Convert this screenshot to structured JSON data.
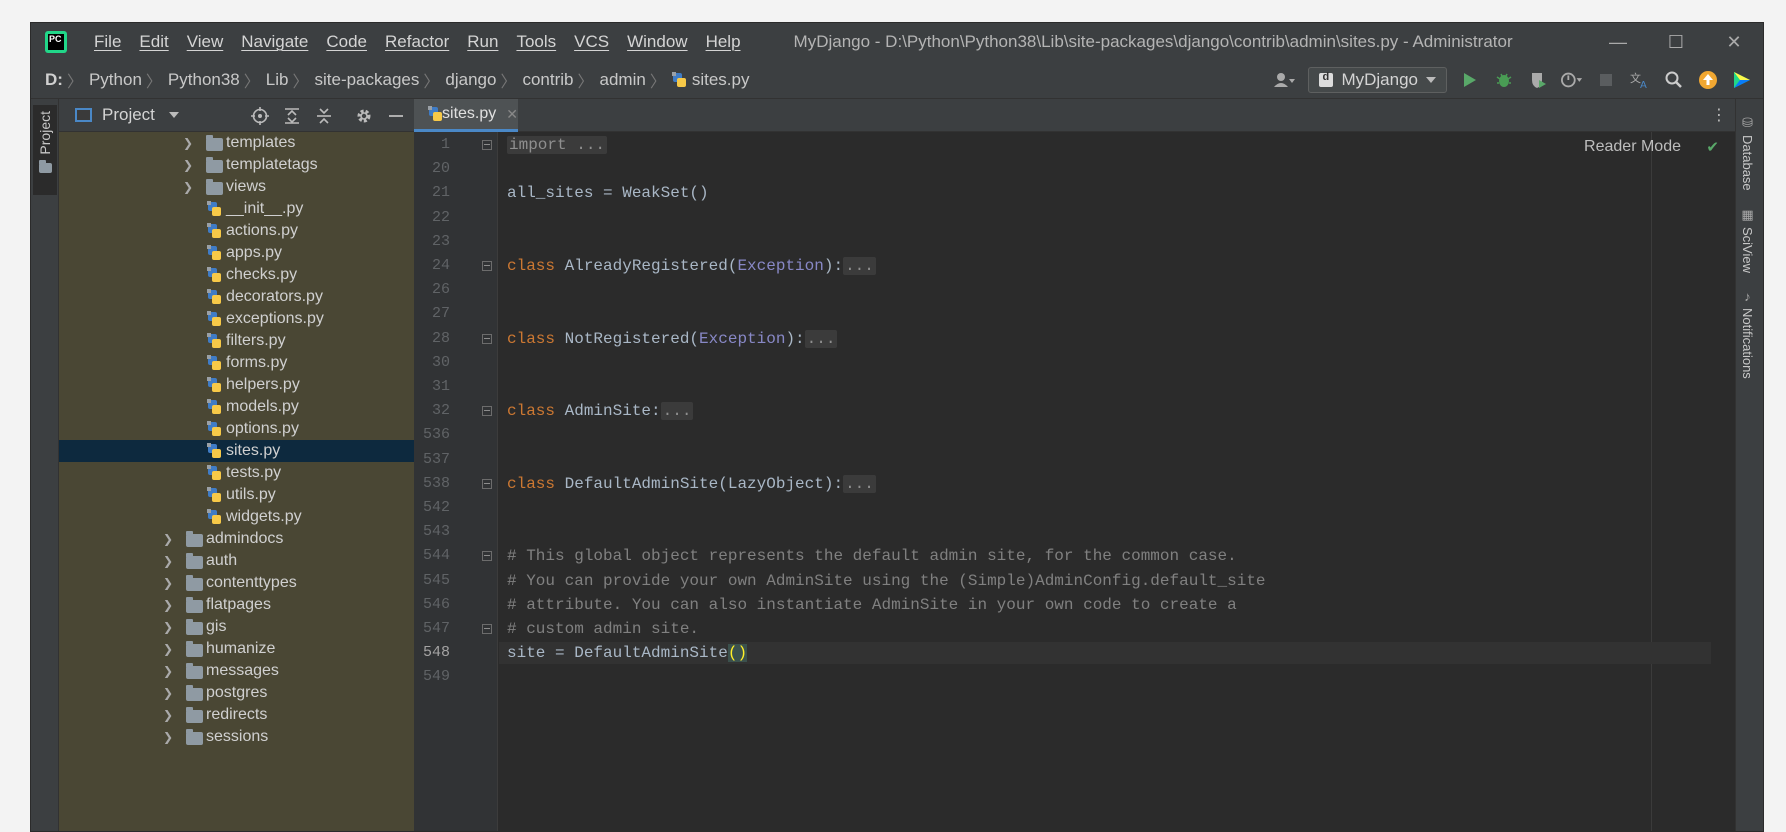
{
  "titlebar": {
    "app_icon_text": "PC",
    "menu": [
      "File",
      "Edit",
      "View",
      "Navigate",
      "Code",
      "Refactor",
      "Run",
      "Tools",
      "VCS",
      "Window",
      "Help"
    ],
    "title": "MyDjango - D:\\Python\\Python38\\Lib\\site-packages\\django\\contrib\\admin\\sites.py - Administrator",
    "controls": {
      "minimize": "—",
      "maximize": "☐",
      "close": "✕"
    }
  },
  "breadcrumb": [
    "D:",
    "Python",
    "Python38",
    "Lib",
    "site-packages",
    "django",
    "contrib",
    "admin",
    "sites.py"
  ],
  "toolbar": {
    "run_config": "MyDjango",
    "icons": [
      "user-icon",
      "run-icon",
      "debug-icon",
      "coverage-icon",
      "profile-icon",
      "stop-icon",
      "translate-icon",
      "search-icon",
      "update-icon",
      "jetbrains-icon"
    ]
  },
  "left_stripe": {
    "project_label": "Project"
  },
  "project_panel": {
    "title": "Project",
    "tree": [
      {
        "label": "templates",
        "type": "folder",
        "level": 2,
        "expandable": true
      },
      {
        "label": "templatetags",
        "type": "folder",
        "level": 2,
        "expandable": true
      },
      {
        "label": "views",
        "type": "folder",
        "level": 2,
        "expandable": true
      },
      {
        "label": "__init__.py",
        "type": "py",
        "level": 2
      },
      {
        "label": "actions.py",
        "type": "py",
        "level": 2
      },
      {
        "label": "apps.py",
        "type": "py",
        "level": 2
      },
      {
        "label": "checks.py",
        "type": "py",
        "level": 2
      },
      {
        "label": "decorators.py",
        "type": "py",
        "level": 2
      },
      {
        "label": "exceptions.py",
        "type": "py",
        "level": 2
      },
      {
        "label": "filters.py",
        "type": "py",
        "level": 2
      },
      {
        "label": "forms.py",
        "type": "py",
        "level": 2
      },
      {
        "label": "helpers.py",
        "type": "py",
        "level": 2
      },
      {
        "label": "models.py",
        "type": "py",
        "level": 2
      },
      {
        "label": "options.py",
        "type": "py",
        "level": 2
      },
      {
        "label": "sites.py",
        "type": "py",
        "level": 2,
        "selected": true
      },
      {
        "label": "tests.py",
        "type": "py",
        "level": 2
      },
      {
        "label": "utils.py",
        "type": "py",
        "level": 2
      },
      {
        "label": "widgets.py",
        "type": "py",
        "level": 2
      },
      {
        "label": "admindocs",
        "type": "folder",
        "level": 1,
        "expandable": true
      },
      {
        "label": "auth",
        "type": "folder",
        "level": 1,
        "expandable": true
      },
      {
        "label": "contenttypes",
        "type": "folder",
        "level": 1,
        "expandable": true
      },
      {
        "label": "flatpages",
        "type": "folder",
        "level": 1,
        "expandable": true
      },
      {
        "label": "gis",
        "type": "folder",
        "level": 1,
        "expandable": true
      },
      {
        "label": "humanize",
        "type": "folder",
        "level": 1,
        "expandable": true
      },
      {
        "label": "messages",
        "type": "folder",
        "level": 1,
        "expandable": true
      },
      {
        "label": "postgres",
        "type": "folder",
        "level": 1,
        "expandable": true
      },
      {
        "label": "redirects",
        "type": "folder",
        "level": 1,
        "expandable": true
      },
      {
        "label": "sessions",
        "type": "folder",
        "level": 1,
        "expandable": true
      }
    ]
  },
  "editor": {
    "tab_label": "sites.py",
    "reader_mode": "Reader Mode",
    "lines": [
      {
        "n": "1",
        "fold": true,
        "parts": [
          {
            "t": "import ...",
            "c": "collapsed"
          }
        ]
      },
      {
        "n": "20",
        "parts": []
      },
      {
        "n": "21",
        "parts": [
          {
            "t": "all_sites = WeakSet()",
            "c": ""
          }
        ]
      },
      {
        "n": "22",
        "parts": []
      },
      {
        "n": "23",
        "parts": []
      },
      {
        "n": "24",
        "fold": true,
        "parts": [
          {
            "t": "class ",
            "c": "kw"
          },
          {
            "t": "AlreadyRegistered(",
            "c": ""
          },
          {
            "t": "Exception",
            "c": "builtin"
          },
          {
            "t": "):",
            "c": ""
          },
          {
            "t": "...",
            "c": "collapsed"
          }
        ]
      },
      {
        "n": "26",
        "parts": []
      },
      {
        "n": "27",
        "parts": []
      },
      {
        "n": "28",
        "fold": true,
        "parts": [
          {
            "t": "class ",
            "c": "kw"
          },
          {
            "t": "NotRegistered(",
            "c": ""
          },
          {
            "t": "Exception",
            "c": "builtin"
          },
          {
            "t": "):",
            "c": ""
          },
          {
            "t": "...",
            "c": "collapsed"
          }
        ]
      },
      {
        "n": "30",
        "parts": []
      },
      {
        "n": "31",
        "parts": []
      },
      {
        "n": "32",
        "fold": true,
        "parts": [
          {
            "t": "class ",
            "c": "kw"
          },
          {
            "t": "AdminSite:",
            "c": ""
          },
          {
            "t": "...",
            "c": "collapsed"
          }
        ]
      },
      {
        "n": "536",
        "parts": []
      },
      {
        "n": "537",
        "parts": []
      },
      {
        "n": "538",
        "fold": true,
        "parts": [
          {
            "t": "class ",
            "c": "kw"
          },
          {
            "t": "DefaultAdminSite(LazyObject):",
            "c": ""
          },
          {
            "t": "...",
            "c": "collapsed"
          }
        ]
      },
      {
        "n": "542",
        "parts": []
      },
      {
        "n": "543",
        "parts": []
      },
      {
        "n": "544",
        "fold": true,
        "parts": [
          {
            "t": "# This global object represents the default admin site, for the common case.",
            "c": "comment"
          }
        ]
      },
      {
        "n": "545",
        "parts": [
          {
            "t": "# You can provide your own AdminSite using the (Simple)AdminConfig.default_site",
            "c": "comment"
          }
        ]
      },
      {
        "n": "546",
        "parts": [
          {
            "t": "# attribute. You can also instantiate AdminSite in your own code to create a",
            "c": "comment"
          }
        ]
      },
      {
        "n": "547",
        "fold": true,
        "parts": [
          {
            "t": "# custom admin site.",
            "c": "comment"
          }
        ]
      },
      {
        "n": "548",
        "current": true,
        "parts": [
          {
            "t": "site = DefaultAdminSite",
            "c": ""
          },
          {
            "t": "()",
            "c": "bracket"
          }
        ]
      },
      {
        "n": "549",
        "parts": []
      }
    ]
  },
  "right_stripe": [
    {
      "label": "Database",
      "icon": "database-icon"
    },
    {
      "label": "SciView",
      "icon": "sciview-icon"
    },
    {
      "label": "Notifications",
      "icon": "bell-icon"
    }
  ]
}
